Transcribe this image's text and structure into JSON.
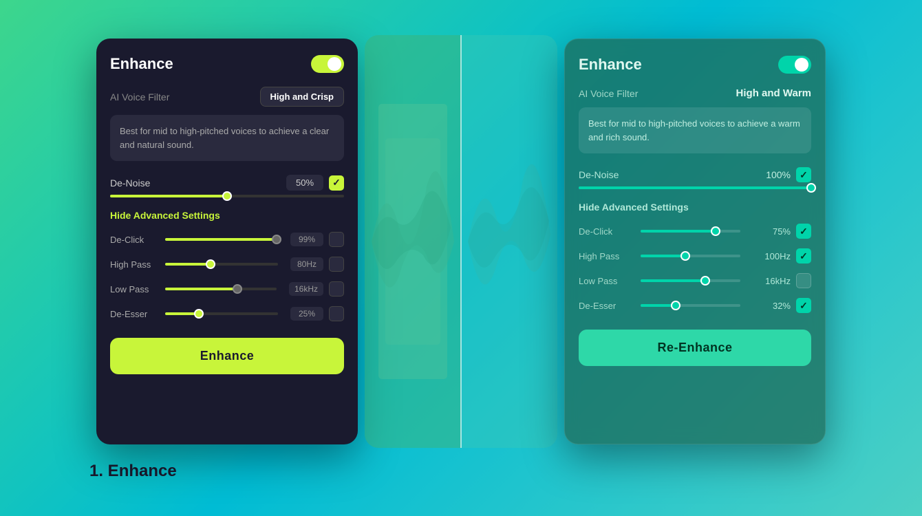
{
  "left_card": {
    "title": "Enhance",
    "toggle_on": true,
    "ai_filter_label": "AI Voice Filter",
    "ai_filter_value": "High and Crisp",
    "description": "Best for mid to high-pitched voices to achieve a clear and natural sound.",
    "denoise_label": "De-Noise",
    "denoise_value": "50%",
    "denoise_percent": 50,
    "hide_advanced": "Hide Advanced Settings",
    "declick_label": "De-Click",
    "declick_value": "99%",
    "declick_percent": 99,
    "highpass_label": "High Pass",
    "highpass_value": "80Hz",
    "highpass_percent": 40,
    "lowpass_label": "Low Pass",
    "lowpass_value": "16kHz",
    "lowpass_percent": 65,
    "deesser_label": "De-Esser",
    "deesser_value": "25%",
    "deesser_percent": 30,
    "enhance_btn": "Enhance"
  },
  "right_card": {
    "title": "Enhance",
    "toggle_on": true,
    "ai_filter_label": "AI Voice Filter",
    "ai_filter_value": "High and Warm",
    "description": "Best for mid to high-pitched voices to achieve a warm and rich sound.",
    "denoise_label": "De-Noise",
    "denoise_value": "100%",
    "denoise_percent": 100,
    "hide_advanced": "Hide Advanced Settings",
    "declick_label": "De-Click",
    "declick_value": "75%",
    "declick_percent": 75,
    "highpass_label": "High Pass",
    "highpass_value": "100Hz",
    "highpass_percent": 45,
    "lowpass_label": "Low Pass",
    "lowpass_value": "16kHz",
    "lowpass_percent": 65,
    "deesser_label": "De-Esser",
    "deesser_value": "32%",
    "deesser_percent": 35,
    "reenhance_btn": "Re-Enhance"
  },
  "step_label": "1. Enhance"
}
